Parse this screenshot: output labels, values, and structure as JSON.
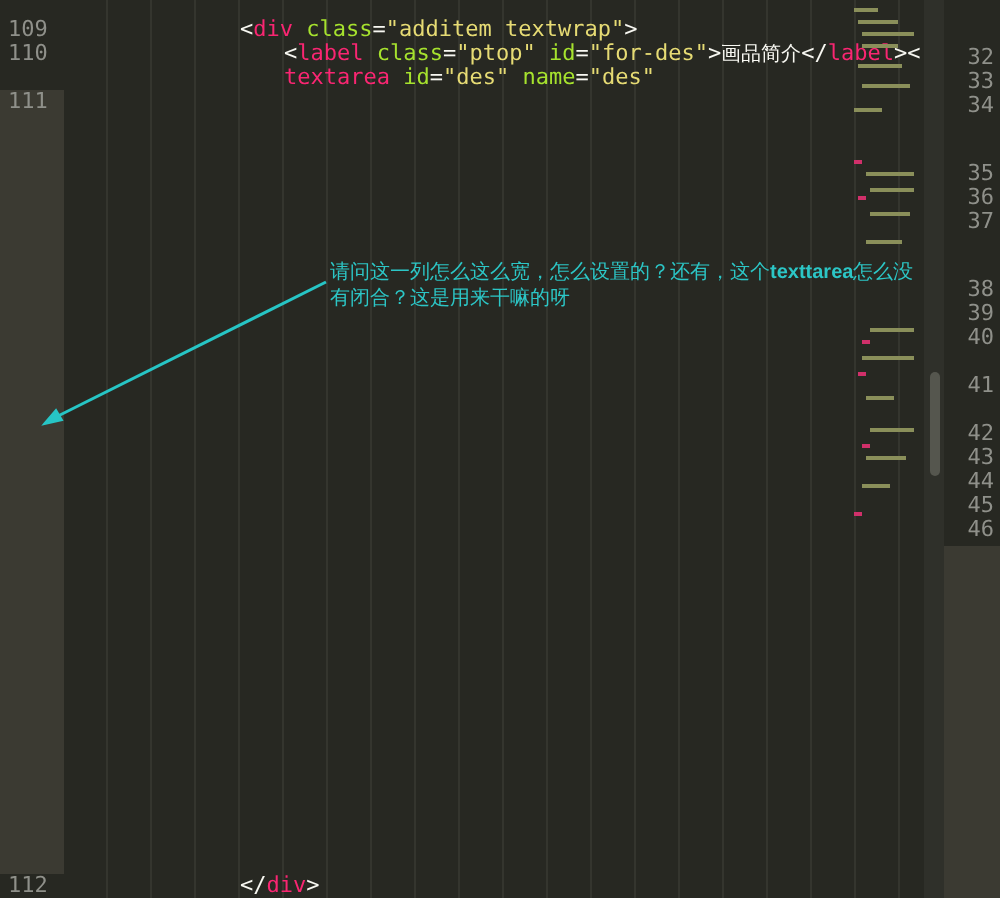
{
  "editor": {
    "lines": [
      {
        "number": "109",
        "segments": [
          [
            {
              "kind": "punct",
              "text": "<"
            },
            {
              "kind": "tag",
              "text": "div"
            },
            {
              "kind": "attr",
              "text": " class"
            },
            {
              "kind": "punct",
              "text": "="
            },
            {
              "kind": "string",
              "text": "\"additem textwrap\""
            },
            {
              "kind": "punct",
              "text": ">"
            }
          ]
        ],
        "children": [
          {
            "number": "110",
            "segments": [
              [
                {
                  "kind": "punct",
                  "text": "<"
                },
                {
                  "kind": "tag",
                  "text": "label"
                },
                {
                  "kind": "attr",
                  "text": " class"
                },
                {
                  "kind": "punct",
                  "text": "="
                },
                {
                  "kind": "string",
                  "text": "\"ptop\""
                },
                {
                  "kind": "attr",
                  "text": " id"
                },
                {
                  "kind": "punct",
                  "text": "="
                },
                {
                  "kind": "string",
                  "text": "\"for-des\""
                },
                {
                  "kind": "punct",
                  "text": ">"
                },
                {
                  "kind": "text",
                  "text": "画品简介"
                },
                {
                  "kind": "punct",
                  "text": "</"
                },
                {
                  "kind": "tag",
                  "text": "label"
                },
                {
                  "kind": "punct",
                  "text": "><"
                }
              ],
              [
                {
                  "kind": "tag",
                  "text": "textarea"
                },
                {
                  "kind": "attr",
                  "text": " id"
                },
                {
                  "kind": "punct",
                  "text": "="
                },
                {
                  "kind": "string",
                  "text": "\"des\""
                },
                {
                  "kind": "attr",
                  "text": " name"
                },
                {
                  "kind": "punct",
                  "text": "="
                },
                {
                  "kind": "string",
                  "text": "\"des\""
                }
              ]
            ]
          },
          {
            "number": "111",
            "long": true
          }
        ]
      },
      {
        "number": "112",
        "segments": [
          [
            {
              "kind": "punct",
              "text": "</"
            },
            {
              "kind": "tag",
              "text": "div"
            },
            {
              "kind": "punct",
              "text": ">"
            }
          ]
        ]
      }
    ]
  },
  "annotation": {
    "text": "请问这一列怎么这么宽，怎么设置的？还有，这个**texttarea**怎么没有闭合？这是用来干嘛的呀"
  },
  "second_pane": {
    "line_numbers": [
      "32",
      "33",
      "34",
      "35",
      "36",
      "37",
      "38",
      "39",
      "40",
      "41",
      "42",
      "43",
      "44",
      "45",
      "46"
    ]
  }
}
